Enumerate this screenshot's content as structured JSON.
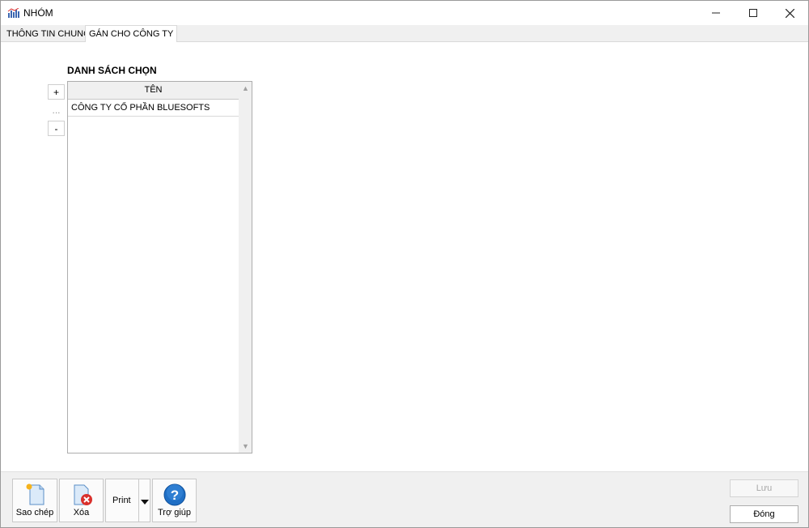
{
  "window": {
    "title": "NHÓM",
    "controls": {
      "minimize": "minimize",
      "maximize": "maximize",
      "close": "close"
    }
  },
  "tabs": [
    {
      "label": "THÔNG TIN CHUNG",
      "active": false
    },
    {
      "label": "GÁN CHO CÔNG TY",
      "active": true
    }
  ],
  "selection_list": {
    "title": "DANH SÁCH CHỌN",
    "side_buttons": {
      "add": "+",
      "more": "...",
      "remove": "-"
    },
    "column_header": "TÊN",
    "rows": [
      "CÔNG TY CỔ PHẦN BLUESOFTS"
    ]
  },
  "toolbar": {
    "copy_label": "Sao chép",
    "delete_label": "Xóa",
    "print_label": "Print",
    "help_label": "Trợ giúp"
  },
  "actions": {
    "save_label": "Lưu",
    "close_label": "Đóng"
  },
  "colors": {
    "accent": "#1f6fc5",
    "delete_red": "#d9302c"
  }
}
